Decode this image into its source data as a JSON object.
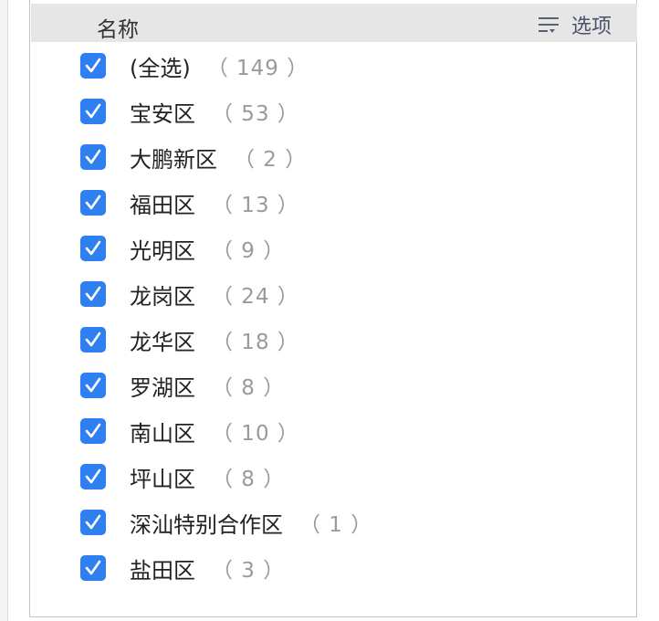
{
  "header": {
    "title": "名称",
    "options_label": "选项"
  },
  "items": [
    {
      "label": "(全选)",
      "count": "（ 149 ）",
      "checked": true
    },
    {
      "label": "宝安区",
      "count": "（ 53 ）",
      "checked": true
    },
    {
      "label": "大鹏新区",
      "count": "（ 2 ）",
      "checked": true
    },
    {
      "label": "福田区",
      "count": "（ 13 ）",
      "checked": true
    },
    {
      "label": "光明区",
      "count": "（ 9 ）",
      "checked": true
    },
    {
      "label": "龙岗区",
      "count": "（ 24 ）",
      "checked": true
    },
    {
      "label": "龙华区",
      "count": "（ 18 ）",
      "checked": true
    },
    {
      "label": "罗湖区",
      "count": "（ 8 ）",
      "checked": true
    },
    {
      "label": "南山区",
      "count": "（ 10 ）",
      "checked": true
    },
    {
      "label": "坪山区",
      "count": "（ 8 ）",
      "checked": true
    },
    {
      "label": "深汕特别合作区",
      "count": "（ 1 ）",
      "checked": true
    },
    {
      "label": "盐田区",
      "count": "（ 3 ）",
      "checked": true
    }
  ],
  "colors": {
    "checkbox": "#2e7ff0",
    "header_bg": "#e6e6e6",
    "count_text": "#9a9a9a"
  }
}
